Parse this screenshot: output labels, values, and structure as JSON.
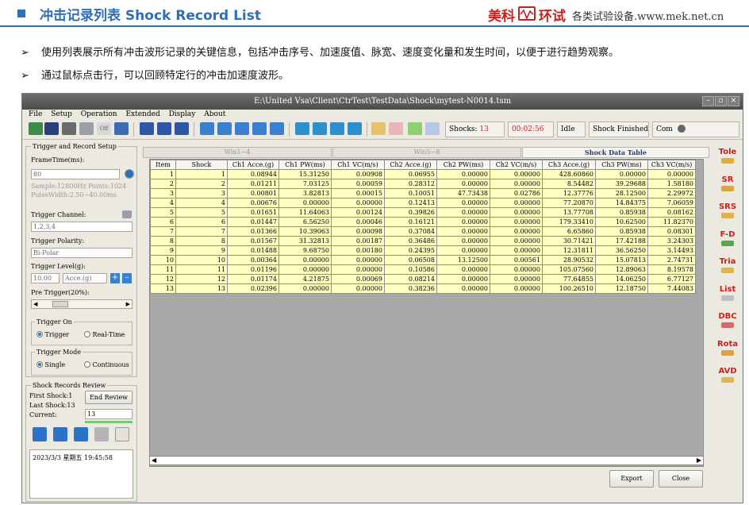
{
  "header": {
    "title": "冲击记录列表 Shock Record List",
    "brand_a": "美科",
    "brand_b": "环试",
    "brand_tagline": "各类试验设备.www.mek.net.cn"
  },
  "bullets": [
    "使用列表展示所有冲击波形记录的关键信息，包括冲击序号、加速度值、脉宽、速度变化量和发生时间，以便于进行趋势观察。",
    "通过鼠标点击行，可以回顾特定行的冲击加速度波形。"
  ],
  "window": {
    "title": "E:\\United Vsa\\Client\\CtrTest\\TestData\\Shock\\mytest-N0014.tsm",
    "menu": [
      "File",
      "Setup",
      "Operation",
      "Extended",
      "Display",
      "About"
    ],
    "status": {
      "shocks_label": "Shocks:",
      "shocks_value": "13",
      "elapsed": "00:02:56",
      "state": "Idle",
      "message": "Shock Finished",
      "com_label": "Com"
    }
  },
  "trigger_setup": {
    "group_title": "Trigger and Record Setup",
    "frame_time_label": "FrameTime(ms):",
    "frame_time_value": "80",
    "sample_info": "Sample:12800Hz   Points:1024",
    "pulse_info": "PulseWidth:2.50~40.00ms",
    "channel_label": "Trigger Channel:",
    "channel_value": "1,2,3,4",
    "polarity_label": "Trigger Polarity:",
    "polarity_value": "Bi-Polar",
    "level_label": "Trigger Level(g):",
    "level_value": "10.00",
    "level_unit": "Acce.(g)",
    "pre_trigger_label": "Pre Trigger(20%):",
    "trigger_on_title": "Trigger On",
    "trigger_on_options": [
      "Trigger",
      "Real-Time"
    ],
    "trigger_mode_title": "Trigger Mode",
    "trigger_mode_options": [
      "Single",
      "Continuous"
    ]
  },
  "review": {
    "group_title": "Shock Records Review",
    "first": "First Shock:1",
    "last": "Last Shock:13",
    "current_label": "Current:",
    "current_value": "13",
    "end_review_label": "End Review",
    "log_entry": "2023/3/3 星期五 19:45:58"
  },
  "tabs": [
    "Win1~4",
    "Win5~8",
    "Shock Data Table"
  ],
  "table": {
    "columns": [
      "Item",
      "Shock",
      "Ch1 Acce.(g)",
      "Ch1 PW(ms)",
      "Ch1 VC(m/s)",
      "Ch2 Acce.(g)",
      "Ch2 PW(ms)",
      "Ch2 VC(m/s)",
      "Ch3 Acce.(g)",
      "Ch3 PW(ms)",
      "Ch3 VC(m/s)"
    ],
    "rows": [
      [
        "1",
        "1",
        "0.08944",
        "15.31250",
        "0.00908",
        "0.06955",
        "0.00000",
        "0.00000",
        "428.60860",
        "0.00000",
        "0.00000"
      ],
      [
        "2",
        "2",
        "0.01211",
        "7.03125",
        "0.00059",
        "0.28312",
        "0.00000",
        "0.00000",
        "8.54482",
        "39.29688",
        "1.58180"
      ],
      [
        "3",
        "3",
        "0.00801",
        "3.82813",
        "0.00015",
        "0.10051",
        "47.73438",
        "0.02786",
        "12.37776",
        "28.12500",
        "2.29972"
      ],
      [
        "4",
        "4",
        "0.00676",
        "0.00000",
        "0.00000",
        "0.12413",
        "0.00000",
        "0.00000",
        "77.20870",
        "14.84375",
        "7.06059"
      ],
      [
        "5",
        "5",
        "0.01651",
        "11.64063",
        "0.00124",
        "0.39826",
        "0.00000",
        "0.00000",
        "13.77708",
        "0.85938",
        "0.08162"
      ],
      [
        "6",
        "6",
        "0.01447",
        "6.56250",
        "0.00046",
        "0.16121",
        "0.00000",
        "0.00000",
        "179.33410",
        "10.62500",
        "11.82370"
      ],
      [
        "7",
        "7",
        "0.01366",
        "10.39063",
        "0.00098",
        "0.37084",
        "0.00000",
        "0.00000",
        "6.65860",
        "0.85938",
        "0.08301"
      ],
      [
        "8",
        "8",
        "0.01567",
        "31.32813",
        "0.00187",
        "0.36486",
        "0.00000",
        "0.00000",
        "30.71421",
        "17.42188",
        "3.24303"
      ],
      [
        "9",
        "9",
        "0.01488",
        "9.68750",
        "0.00180",
        "0.24395",
        "0.00000",
        "0.00000",
        "12.31811",
        "36.56250",
        "3.14493"
      ],
      [
        "10",
        "10",
        "0.00364",
        "0.00000",
        "0.00000",
        "0.06508",
        "13.12500",
        "0.00561",
        "28.90532",
        "15.07813",
        "2.74731"
      ],
      [
        "11",
        "11",
        "0.01196",
        "0.00000",
        "0.00000",
        "0.10586",
        "0.00000",
        "0.00000",
        "105.07560",
        "12.89063",
        "8.19578"
      ],
      [
        "12",
        "12",
        "0.01174",
        "4.21875",
        "0.00069",
        "0.08214",
        "0.00000",
        "0.00000",
        "77.64855",
        "14.06250",
        "6.77127"
      ],
      [
        "13",
        "13",
        "0.02396",
        "0.00000",
        "0.00000",
        "0.38236",
        "0.00000",
        "0.00000",
        "100.26510",
        "12.18750",
        "7.44083"
      ]
    ]
  },
  "buttons": {
    "export": "Export",
    "close": "Close"
  },
  "sidebar": [
    "Tole",
    "SR",
    "SRS",
    "F-D",
    "Tria",
    "List",
    "DBC",
    "Rota",
    "AVD"
  ],
  "colors": {
    "accent": "#2e6fb7",
    "brand_red": "#c8201f",
    "row_fill": "#ffffc2"
  }
}
